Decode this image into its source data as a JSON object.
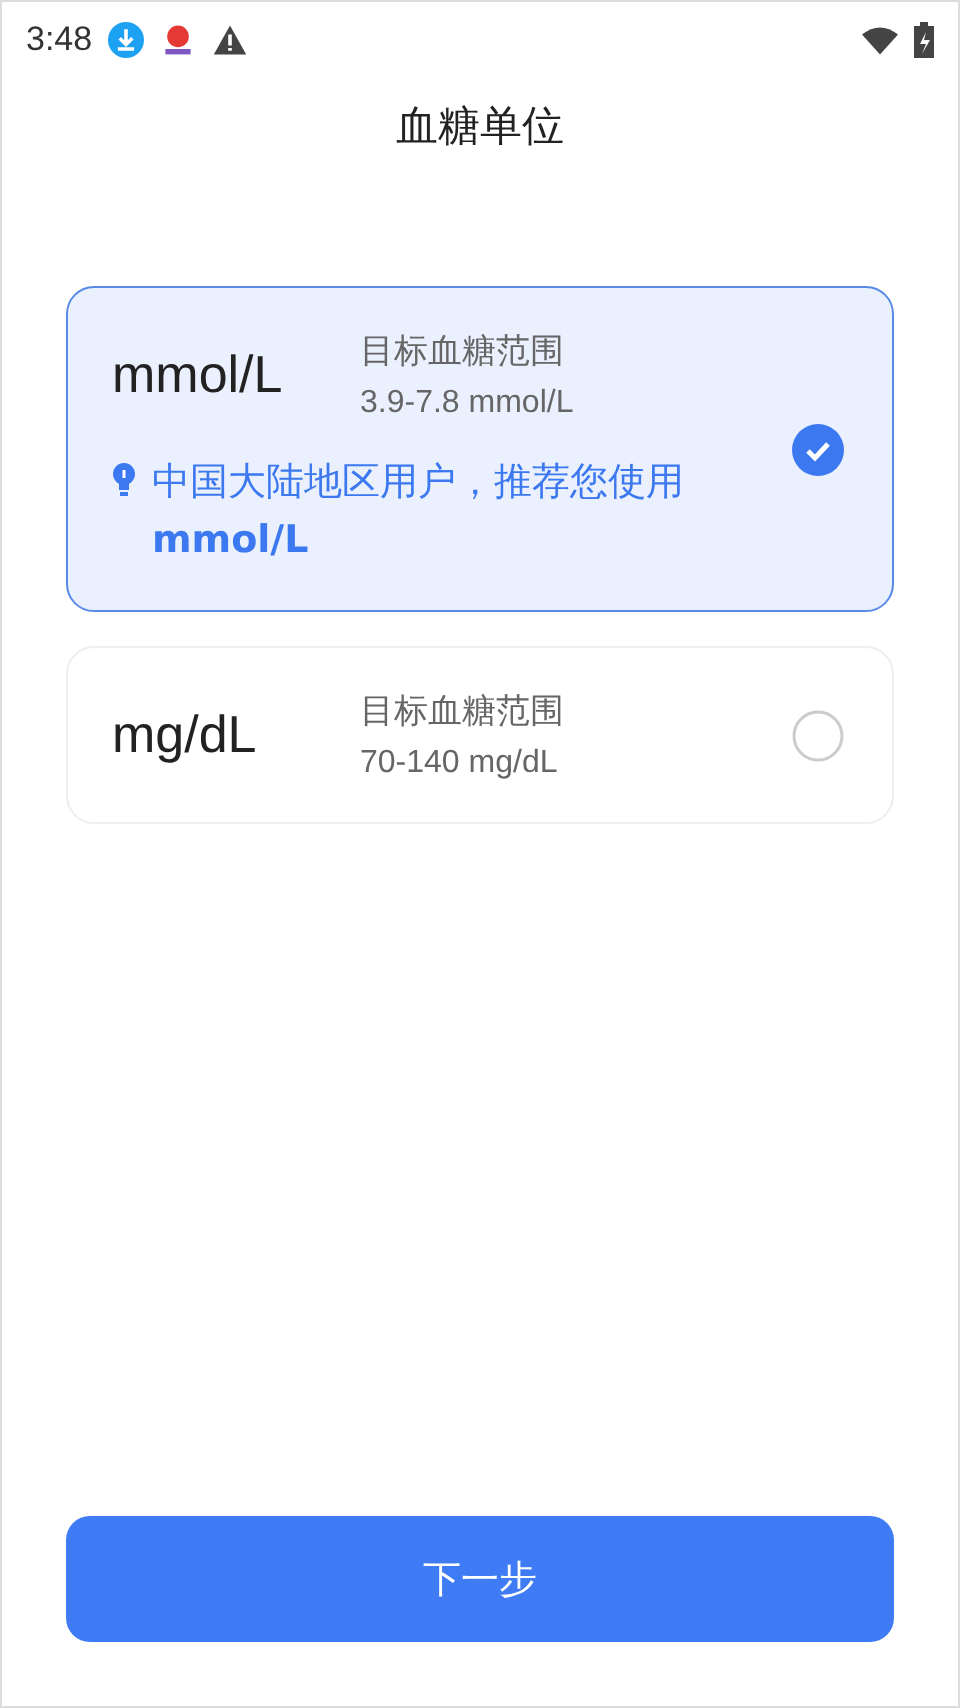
{
  "status_bar": {
    "time": "3:48"
  },
  "title": "血糖单位",
  "options": [
    {
      "unit": "mmol/L",
      "range_label": "目标血糖范围",
      "range": "3.9-7.8 mmol/L",
      "tip": "中国大陆地区用户，推荐您使用**mmol/L**",
      "selected": true
    },
    {
      "unit": "mg/dL",
      "range_label": "目标血糖范围",
      "range": "70-140 mg/dL",
      "selected": false
    }
  ],
  "next_button": "下一步"
}
